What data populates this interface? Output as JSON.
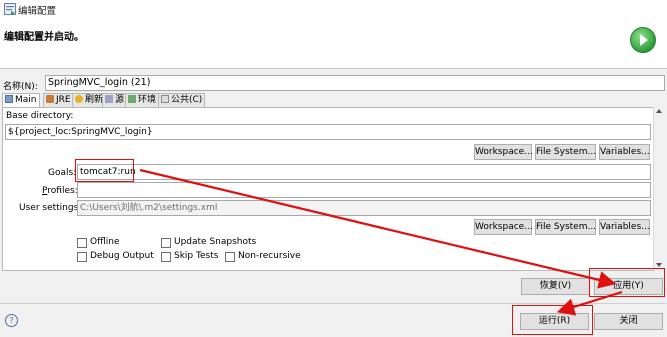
{
  "window": {
    "title": "编辑配置"
  },
  "header": {
    "title": "编辑配置并启动。"
  },
  "name": {
    "label": "名称(N):",
    "value": "SpringMVC_login (21)"
  },
  "tabs": [
    {
      "label": "Main",
      "icon": "main-tab-icon"
    },
    {
      "label": "JRE",
      "icon": "jre-icon"
    },
    {
      "label": "刷新",
      "icon": "refresh-icon"
    },
    {
      "label": "源",
      "icon": "source-icon"
    },
    {
      "label": "环境",
      "icon": "environment-icon"
    },
    {
      "label": "公共(C)",
      "icon": "common-icon"
    }
  ],
  "main": {
    "base_dir_label": "Base directory:",
    "base_dir_value": "${project_loc:SpringMVC_login}",
    "workspace_btn": "Workspace...",
    "filesystem_btn": "File System...",
    "variables_btn": "Variables...",
    "goals_label": "Goals:",
    "goals_value": "tomcat7:run",
    "profiles_label": "Profiles:",
    "profiles_value": "",
    "user_settings_label": "User settings:",
    "user_settings_value": "C:\\Users\\刘航\\.m2\\settings.xml",
    "workspace_btn2": "Workspace...",
    "filesystem_btn2": "File System...",
    "variables_btn2": "Variables...",
    "checkboxes": {
      "offline": "Offline",
      "update_snapshots": "Update Snapshots",
      "debug_output": "Debug Output",
      "skip_tests": "Skip Tests",
      "non_recursive": "Non-recursive"
    }
  },
  "actions": {
    "revert": "恢复(V)",
    "apply": "应用(Y)",
    "run": "运行(R)",
    "close": "关闭"
  },
  "annotation_color": "#e01010"
}
